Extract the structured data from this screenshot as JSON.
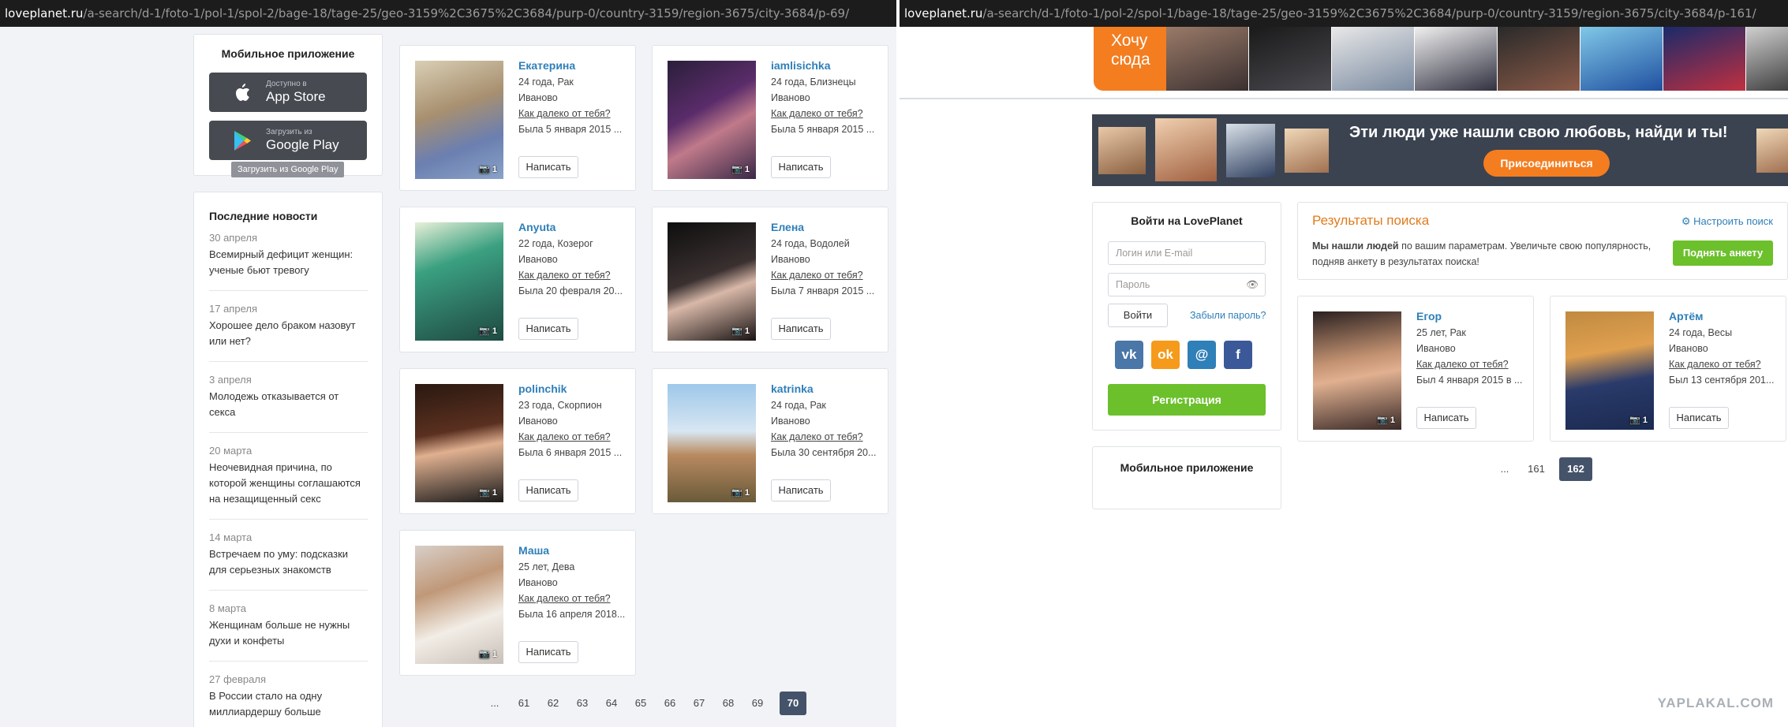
{
  "left": {
    "url": {
      "host": "loveplanet.ru",
      "path": "/a-search/d-1/foto-1/pol-1/spol-2/bage-18/tage-25/geo-3159%2C3675%2C3684/purp-0/country-3159/region-3675/city-3684/p-69/"
    },
    "mobile": {
      "title": "Мобильное приложение",
      "appstore_small": "Доступно в",
      "appstore_big": "App Store",
      "gplay_small": "Загрузить из",
      "gplay_big": "Google Play",
      "tooltip": "Загрузить из Google Play"
    },
    "news": {
      "title": "Последние новости",
      "items": [
        {
          "date": "30 апреля",
          "text": "Всемирный дефицит женщин: ученые бьют тревогу"
        },
        {
          "date": "17 апреля",
          "text": "Хорошее дело браком назовут или нет?"
        },
        {
          "date": "3 апреля",
          "text": "Молодежь отказывается от секса"
        },
        {
          "date": "20 марта",
          "text": "Неочевидная причина, по которой женщины соглашаются на незащищенный секс"
        },
        {
          "date": "14 марта",
          "text": "Встречаем по уму: подсказки для серьезных знакомств"
        },
        {
          "date": "8 марта",
          "text": "Женщинам больше не нужны духи и конфеты"
        },
        {
          "date": "27 февраля",
          "text": "В России стало на одну миллиардершу больше"
        }
      ]
    },
    "profiles": [
      {
        "name": "Екатерина",
        "age": "24 года, Рак",
        "city": "Иваново",
        "distance": "Как далеко от тебя?",
        "seen": "Была 5 января 2015 ...",
        "photos": "1",
        "write": "Написать"
      },
      {
        "name": "iamlisichka",
        "age": "24 года, Близнецы",
        "city": "Иваново",
        "distance": "Как далеко от тебя?",
        "seen": "Была 5 января 2015 ...",
        "photos": "1",
        "write": "Написать"
      },
      {
        "name": "Anyuta",
        "age": "22 года, Козерог",
        "city": "Иваново",
        "distance": "Как далеко от тебя?",
        "seen": "Была 20 февраля 20...",
        "photos": "1",
        "write": "Написать"
      },
      {
        "name": "Елена",
        "age": "24 года, Водолей",
        "city": "Иваново",
        "distance": "Как далеко от тебя?",
        "seen": "Была 7 января 2015 ...",
        "photos": "1",
        "write": "Написать"
      },
      {
        "name": "polinchik",
        "age": "23 года, Скорпион",
        "city": "Иваново",
        "distance": "Как далеко от тебя?",
        "seen": "Была 6 января 2015 ...",
        "photos": "1",
        "write": "Написать"
      },
      {
        "name": "katrinka",
        "age": "24 года, Рак",
        "city": "Иваново",
        "distance": "Как далеко от тебя?",
        "seen": "Была 30 сентября 20...",
        "photos": "1",
        "write": "Написать"
      },
      {
        "name": "Маша",
        "age": "25 лет, Дева",
        "city": "Иваново",
        "distance": "Как далеко от тебя?",
        "seen": "Была 16 апреля 2018...",
        "photos": "1",
        "write": "Написать"
      }
    ],
    "pager": [
      "...",
      "61",
      "62",
      "63",
      "64",
      "65",
      "66",
      "67",
      "68",
      "69",
      "70"
    ]
  },
  "right": {
    "url": {
      "host": "loveplanet.ru",
      "path": "/a-search/d-1/foto-1/pol-2/spol-1/bage-18/tage-25/geo-3159%2C3675%2C3684/purp-0/country-3159/region-3675/city-3684/p-161/"
    },
    "hochu": "Хочу сюда",
    "banner": {
      "text": "Эти люди уже нашли свою любовь, найди и ты!",
      "button": "Присоединиться"
    },
    "login": {
      "title": "Войти на LovePlanet",
      "login_placeholder": "Логин или E-mail",
      "password_placeholder": "Пароль",
      "submit": "Войти",
      "forgot": "Забыли пароль?",
      "register": "Регистрация",
      "social": [
        "vk",
        "ok",
        "@",
        "f"
      ]
    },
    "mobile_title": "Мобильное приложение",
    "results": {
      "title": "Результаты поиска",
      "config": "Настроить поиск",
      "text_bold": "Мы нашли людей",
      "text": " по вашим параметрам. Увеличьте свою популярность, подняв анкету в результатах поиска!",
      "raise": "Поднять анкету"
    },
    "profiles": [
      {
        "name": "Егор",
        "age": "25 лет, Рак",
        "city": "Иваново",
        "distance": "Как далеко от тебя?",
        "seen": "Был 4 января 2015 в ...",
        "photos": "1",
        "write": "Написать"
      },
      {
        "name": "Артём",
        "age": "24 года, Весы",
        "city": "Иваново",
        "distance": "Как далеко от тебя?",
        "seen": "Был 13 сентября 201...",
        "photos": "1",
        "write": "Написать"
      }
    ],
    "pager": [
      "...",
      "161",
      "162"
    ]
  },
  "watermark": "YAPLAKAL.COM",
  "colors": {
    "accent_link": "#2f7fb8",
    "orange": "#f47d20",
    "green": "#6cc02c",
    "pager_active": "#44536a"
  }
}
